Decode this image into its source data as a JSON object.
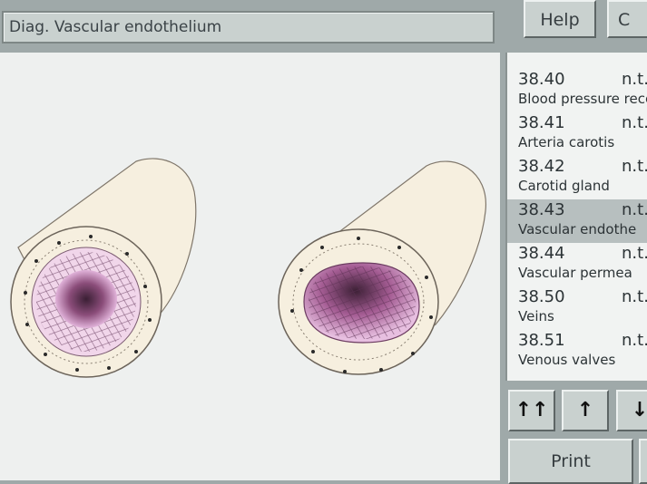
{
  "title_field": {
    "text": "Diag.  Vascular endothelium"
  },
  "top_buttons": {
    "help": "Help",
    "close": "C"
  },
  "list": {
    "items": [
      {
        "code": "38.40",
        "status": "n.t.",
        "name": "Blood pressure recep",
        "selected": false
      },
      {
        "code": "38.41",
        "status": "n.t.",
        "name": "Arteria carotis",
        "selected": false
      },
      {
        "code": "38.42",
        "status": "n.t.",
        "name": "Carotid gland",
        "selected": false
      },
      {
        "code": "38.43",
        "status": "n.t.",
        "name": "Vascular endothe",
        "selected": true
      },
      {
        "code": "38.44",
        "status": "n.t.",
        "name": "Vascular permea",
        "selected": false
      },
      {
        "code": "38.50",
        "status": "n.t.",
        "name": "Veins",
        "selected": false
      },
      {
        "code": "38.51",
        "status": "n.t.",
        "name": "Venous valves",
        "selected": false
      }
    ]
  },
  "nav": {
    "first": "↑↑",
    "up": "↑",
    "down": "↓"
  },
  "footer": {
    "print": "Print"
  },
  "colors": {
    "selected_row": "#b7bfbf",
    "panel": "#9fa9a9",
    "vessel_wall": "#f3ecdc",
    "lumen": "#d69ccf"
  }
}
